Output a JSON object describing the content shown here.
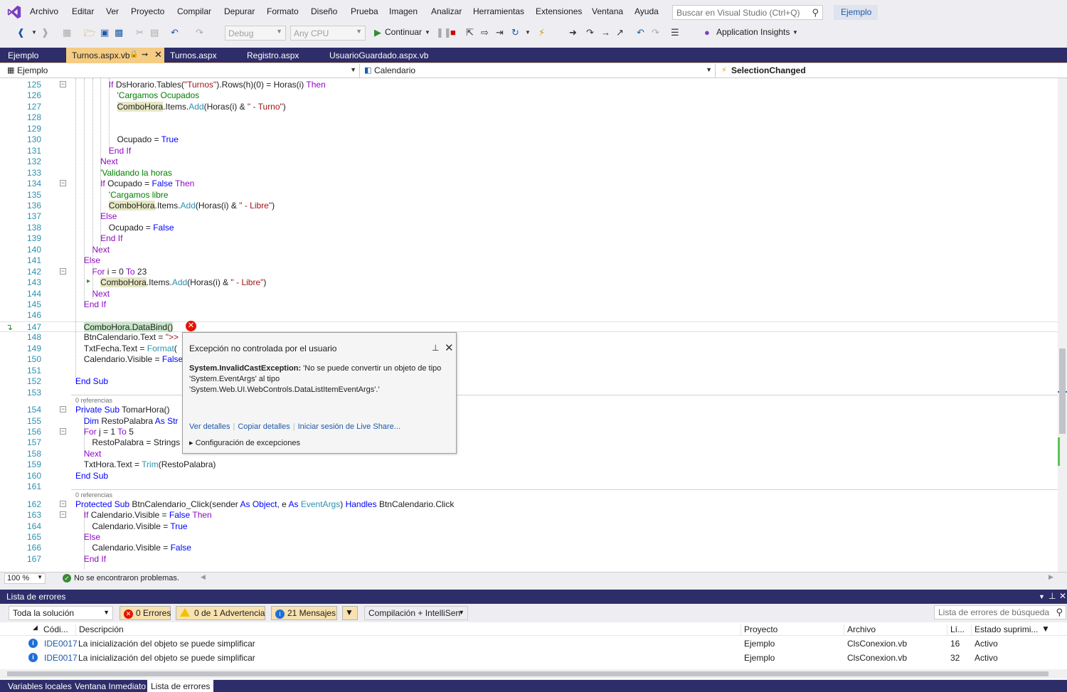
{
  "menubar": {
    "items": [
      "Archivo",
      "Editar",
      "Ver",
      "Proyecto",
      "Compilar",
      "Depurar",
      "Formato",
      "Diseño",
      "Prueba",
      "Imagen",
      "Analizar",
      "Herramientas",
      "Extensiones",
      "Ventana",
      "Ayuda"
    ],
    "search_placeholder": "Buscar en Visual Studio (Ctrl+Q)",
    "solution_name": "Ejemplo"
  },
  "toolbar": {
    "config": "Debug",
    "platform": "Any CPU",
    "continue_label": "Continuar",
    "app_insights": "Application Insights"
  },
  "doc_tabs": [
    {
      "label": "Ejemplo"
    },
    {
      "label": "Turnos.aspx.vb",
      "active": true
    },
    {
      "label": "Turnos.aspx"
    },
    {
      "label": "Registro.aspx"
    },
    {
      "label": "UsuarioGuardado.aspx.vb"
    }
  ],
  "navbar": {
    "project": "Ejemplo",
    "object": "Calendario",
    "event": "SelectionChanged"
  },
  "code_lines": [
    {
      "n": "125",
      "segs": [
        [
          "kwp",
          "If "
        ],
        [
          "",
          "DsHorario.Tables("
        ],
        [
          "str",
          "\"Turnos\""
        ],
        [
          "",
          ").Rows(h)(0) = Horas(i) "
        ],
        [
          "kwp",
          "Then"
        ]
      ]
    },
    {
      "n": "126",
      "segs": [
        [
          "cmt",
          "'Cargamos Ocupados"
        ]
      ]
    },
    {
      "n": "127",
      "segs": [
        [
          "hl",
          "ComboHora"
        ],
        [
          "",
          ".Items."
        ],
        [
          "ty",
          "Add"
        ],
        [
          "",
          "(Horas(i) & "
        ],
        [
          "str",
          "\" - Turno\""
        ],
        [
          "",
          ")"
        ]
      ]
    },
    {
      "n": "128",
      "segs": []
    },
    {
      "n": "129",
      "segs": []
    },
    {
      "n": "130",
      "segs": [
        [
          "",
          "Ocupado = "
        ],
        [
          "kw",
          "True"
        ]
      ]
    },
    {
      "n": "131",
      "segs": [
        [
          "kwp",
          "End If"
        ]
      ]
    },
    {
      "n": "132",
      "segs": [
        [
          "kwp",
          "Next"
        ]
      ]
    },
    {
      "n": "133",
      "segs": [
        [
          "cmt",
          "'Validando la horas"
        ]
      ]
    },
    {
      "n": "134",
      "segs": [
        [
          "kwp",
          "If "
        ],
        [
          "",
          "Ocupado = "
        ],
        [
          "kw",
          "False "
        ],
        [
          "kwp",
          "Then"
        ]
      ]
    },
    {
      "n": "135",
      "segs": [
        [
          "cmt",
          "'Cargamos libre"
        ]
      ]
    },
    {
      "n": "136",
      "segs": [
        [
          "hl",
          "ComboHora"
        ],
        [
          "",
          ".Items."
        ],
        [
          "ty",
          "Add"
        ],
        [
          "",
          "(Horas(i) & "
        ],
        [
          "str",
          "\" - Libre\""
        ],
        [
          "",
          ")"
        ]
      ]
    },
    {
      "n": "137",
      "segs": [
        [
          "kwp",
          "Else"
        ]
      ]
    },
    {
      "n": "138",
      "segs": [
        [
          "",
          "Ocupado = "
        ],
        [
          "kw",
          "False"
        ]
      ]
    },
    {
      "n": "139",
      "segs": [
        [
          "kwp",
          "End If"
        ]
      ]
    },
    {
      "n": "140",
      "segs": [
        [
          "kwp",
          "Next"
        ]
      ]
    },
    {
      "n": "141",
      "segs": [
        [
          "kwp",
          "Else"
        ]
      ]
    },
    {
      "n": "142",
      "segs": [
        [
          "kwp",
          "For "
        ],
        [
          "",
          "i = 0 "
        ],
        [
          "kwp",
          "To "
        ],
        [
          "",
          "23"
        ]
      ]
    },
    {
      "n": "143",
      "segs": [
        [
          "hl",
          "ComboHora"
        ],
        [
          "",
          ".Items."
        ],
        [
          "ty",
          "Add"
        ],
        [
          "",
          "(Horas(i) & "
        ],
        [
          "str",
          "\" - Libre\""
        ],
        [
          "",
          ")"
        ]
      ]
    },
    {
      "n": "144",
      "segs": [
        [
          "kwp",
          "Next"
        ]
      ]
    },
    {
      "n": "145",
      "segs": [
        [
          "kwp",
          "End If"
        ]
      ]
    },
    {
      "n": "146",
      "segs": []
    },
    {
      "n": "147",
      "segs": [
        [
          "hlg",
          "ComboHora.DataBind()"
        ]
      ]
    },
    {
      "n": "148",
      "segs": [
        [
          "",
          "BtnCalendario.Text = "
        ],
        [
          "str",
          "\">>"
        ]
      ]
    },
    {
      "n": "149",
      "segs": [
        [
          "",
          "TxtFecha.Text = "
        ],
        [
          "ty",
          "Format"
        ],
        [
          "",
          "("
        ]
      ]
    },
    {
      "n": "150",
      "segs": [
        [
          "",
          "Calendario.Visible = "
        ],
        [
          "kw",
          "False"
        ]
      ]
    },
    {
      "n": "151",
      "segs": []
    },
    {
      "n": "152",
      "segs": [
        [
          "kw",
          "End Sub"
        ]
      ]
    },
    {
      "n": "153",
      "segs": []
    },
    {
      "n": "154",
      "segs": [
        [
          "kw",
          "Private Sub "
        ],
        [
          "",
          "TomarHora()"
        ]
      ]
    },
    {
      "n": "155",
      "segs": [
        [
          "kw",
          "Dim "
        ],
        [
          "",
          "RestoPalabra "
        ],
        [
          "kw",
          "As Str"
        ]
      ]
    },
    {
      "n": "156",
      "segs": [
        [
          "kwp",
          "For "
        ],
        [
          "",
          "j = 1 "
        ],
        [
          "kwp",
          "To "
        ],
        [
          "",
          "5"
        ]
      ]
    },
    {
      "n": "157",
      "segs": [
        [
          "",
          "RestoPalabra = Strings"
        ]
      ]
    },
    {
      "n": "158",
      "segs": [
        [
          "kwp",
          "Next"
        ]
      ]
    },
    {
      "n": "159",
      "segs": [
        [
          "",
          "TxtHora.Text = "
        ],
        [
          "ty",
          "Trim"
        ],
        [
          "",
          "(RestoPalabra)"
        ]
      ]
    },
    {
      "n": "160",
      "segs": [
        [
          "kw",
          "End Sub"
        ]
      ]
    },
    {
      "n": "161",
      "segs": []
    },
    {
      "n": "162",
      "segs": [
        [
          "kw",
          "Protected Sub "
        ],
        [
          "",
          "BtnCalendario_Click(sender "
        ],
        [
          "kw",
          "As Object"
        ],
        [
          "",
          ", e "
        ],
        [
          "kw",
          "As "
        ],
        [
          "ty",
          "EventArgs"
        ],
        [
          "",
          ") "
        ],
        [
          "kw",
          "Handles "
        ],
        [
          "",
          "BtnCalendario.Click"
        ]
      ]
    },
    {
      "n": "163",
      "segs": [
        [
          "kwp",
          "If "
        ],
        [
          "",
          "Calendario.Visible = "
        ],
        [
          "kw",
          "False "
        ],
        [
          "kwp",
          "Then"
        ]
      ]
    },
    {
      "n": "164",
      "segs": [
        [
          "",
          "Calendario.Visible = "
        ],
        [
          "kw",
          "True"
        ]
      ]
    },
    {
      "n": "165",
      "segs": [
        [
          "kwp",
          "Else"
        ]
      ]
    },
    {
      "n": "166",
      "segs": [
        [
          "",
          "Calendario.Visible = "
        ],
        [
          "kw",
          "False"
        ]
      ]
    },
    {
      "n": "167",
      "segs": [
        [
          "kwp",
          "End If"
        ]
      ]
    }
  ],
  "code_refs": [
    "0 referencias",
    "0 referencias"
  ],
  "exception": {
    "title": "Excepción no controlada por el usuario",
    "type": "System.InvalidCastException:",
    "message": " 'No se puede convertir un objeto de tipo 'System.EventArgs' al tipo 'System.Web.UI.WebControls.DataListItemEventArgs'.'",
    "link_details": "Ver detalles",
    "link_copy": "Copiar detalles",
    "link_liveshare": "Iniciar sesión de Live Share...",
    "config": "Configuración de excepciones"
  },
  "editor_status": {
    "zoom": "100 %",
    "problems": "No se encontraron problemas."
  },
  "errorlist": {
    "title": "Lista de errores",
    "scope": "Toda la solución",
    "errors": "0 Errores",
    "warnings": "0 de 1 Advertencia",
    "messages": "21 Mensajes",
    "build_filter": "Compilación + IntelliSen",
    "search_placeholder": "Lista de errores de búsqueda",
    "columns": [
      "Códi...",
      "Descripción",
      "Proyecto",
      "Archivo",
      "Lí...",
      "Estado suprimi..."
    ],
    "rows": [
      {
        "code": "IDE0017",
        "desc": "La inicialización del objeto se puede simplificar",
        "project": "Ejemplo",
        "file": "ClsConexion.vb",
        "line": "16",
        "state": "Activo"
      },
      {
        "code": "IDE0017",
        "desc": "La inicialización del objeto se puede simplificar",
        "project": "Ejemplo",
        "file": "ClsConexion.vb",
        "line": "32",
        "state": "Activo"
      }
    ]
  },
  "bottom_tabs": [
    "Variables locales",
    "Ventana Inmediato",
    "Lista de errores"
  ]
}
